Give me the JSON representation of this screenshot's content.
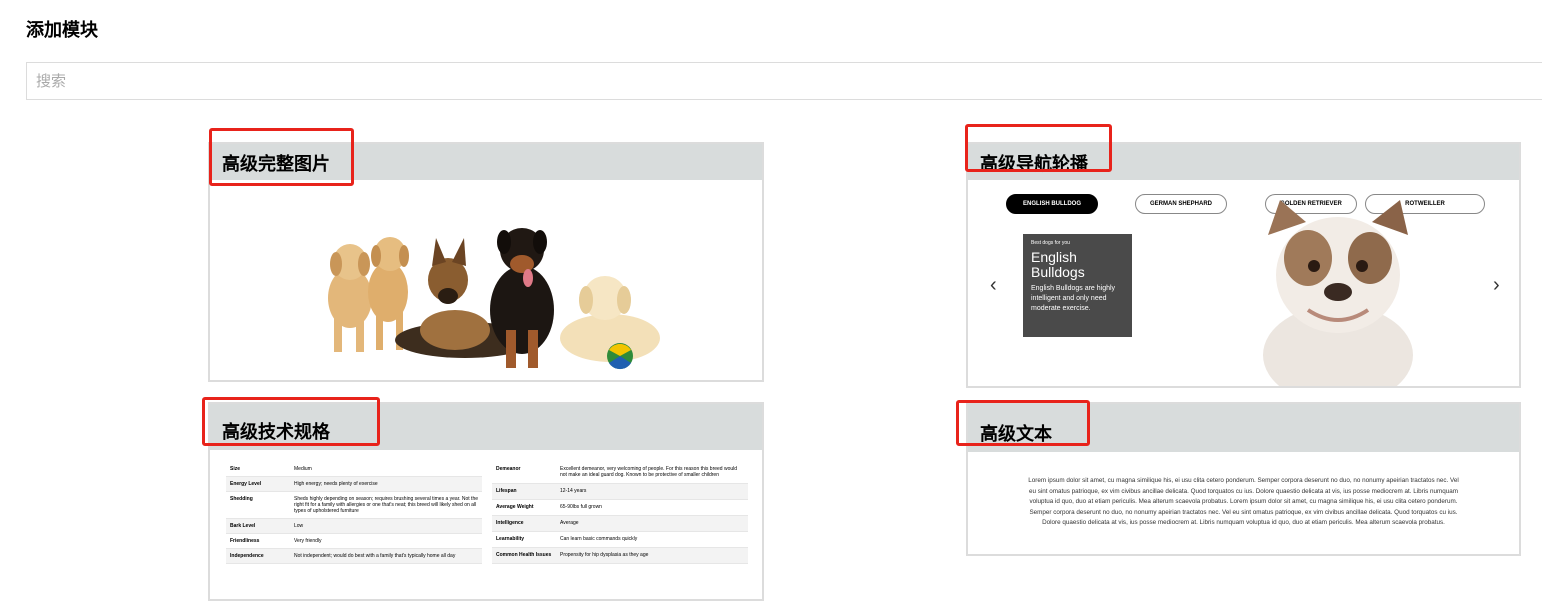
{
  "page": {
    "title": "添加模块"
  },
  "search": {
    "placeholder": "搜索",
    "value": ""
  },
  "accent_color": "#e8231b",
  "modules": {
    "image": {
      "title": "高级完整图片"
    },
    "carousel": {
      "title": "高级导航轮播",
      "tabs": [
        "ENGLISH BULLDOG",
        "GERMAN SHEPHARD",
        "GOLDEN RETRIEVER",
        "ROTWEILLER"
      ],
      "active_tab": "ENGLISH BULLDOG",
      "kicker": "Best dogs for you",
      "heading": "English Bulldogs",
      "desc": "English Bulldogs are highly intelligent and only need moderate exercise.",
      "prev_icon": "‹",
      "next_icon": "›"
    },
    "specs": {
      "title": "高级技术规格",
      "left": [
        {
          "k": "Size",
          "v": "Medium"
        },
        {
          "k": "Energy Level",
          "v": "High energy; needs plenty of exercise"
        },
        {
          "k": "Shedding",
          "v": "Sheds highly depending on season; requires brushing several times a year. Not the right fit for a family with allergies or one that's neat; this breed will likely shed on all types of upholstered furniture"
        },
        {
          "k": "Bark Level",
          "v": "Low"
        },
        {
          "k": "Friendliness",
          "v": "Very friendly"
        },
        {
          "k": "Independence",
          "v": "Not independent; would do best with a family that's typically home all day"
        }
      ],
      "right": [
        {
          "k": "Demeanor",
          "v": "Excellent demeanor, very welcoming of people. For this reason this breed would not make an ideal guard dog. Known to be protective of smaller children"
        },
        {
          "k": "Lifespan",
          "v": "12-14 years"
        },
        {
          "k": "Average Weight",
          "v": "65-90lbs full grown"
        },
        {
          "k": "Intelligence",
          "v": "Average"
        },
        {
          "k": "Learnability",
          "v": "Can learn basic commands quickly"
        },
        {
          "k": "Common Health Issues",
          "v": "Propensity for hip dysplasia as they age"
        }
      ]
    },
    "text": {
      "title": "高级文本",
      "body": "Lorem ipsum dolor sit amet, cu magna similique his, ei usu clita cetero ponderum. Semper corpora deserunt no duo, no nonumy apeirian tractatos nec. Vel eu sint omatus patrioque, ex vim civibus ancillae delicata. Quod torquatos cu ius. Dolore quaestio delicata at vis, ius posse mediocrem at. Libris numquam voluptua id quo, duo at etiam periculis. Mea alterum scaevola probatus. Lorem ipsum dolor sit amet, cu magna similique his, ei usu clita cetero ponderum. Semper corpora deserunt no duo, no nonumy apeirian tractatos nec. Vel eu sint omatus patrioque, ex vim civibus ancillae delicata. Quod torquatos cu ius. Dolore quaestio delicata at vis, ius posse mediocrem at. Libris numquam voluptua id quo, duo at etiam periculis. Mea alterum scaevola probatus."
    }
  }
}
